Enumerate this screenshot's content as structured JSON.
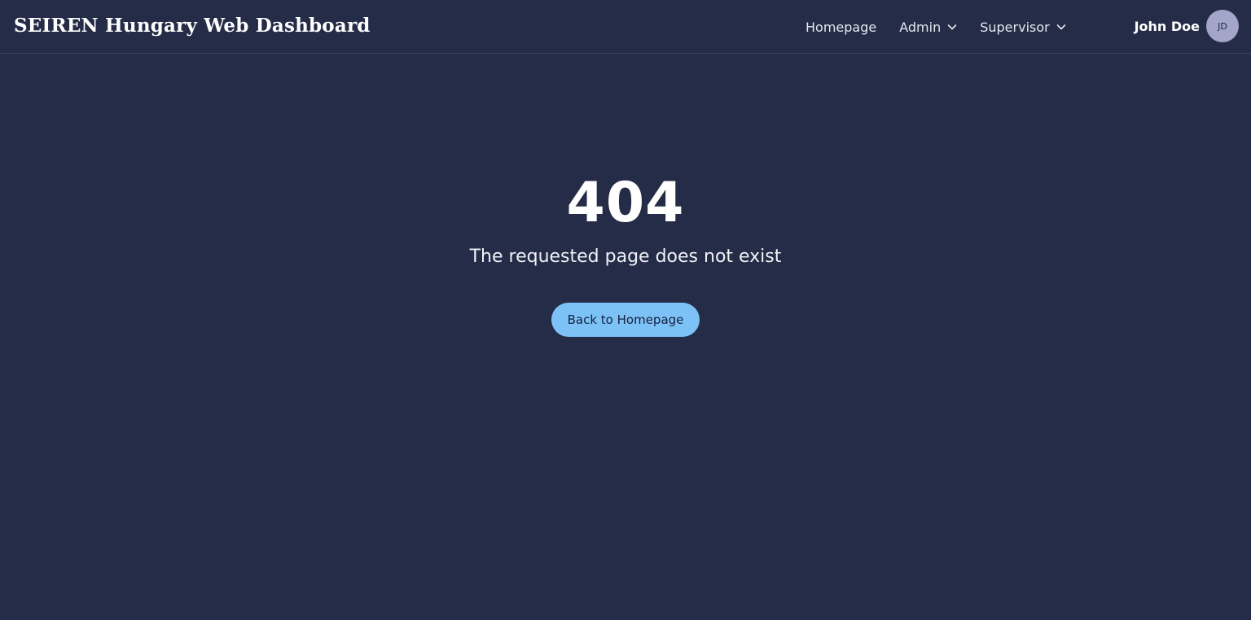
{
  "navbar": {
    "brand": "SEIREN Hungary Web Dashboard",
    "links": [
      {
        "label": "Homepage"
      },
      {
        "label": "Admin",
        "icon": "chevron-down-icon"
      },
      {
        "label": "Supervisor",
        "icon": "chevron-down-icon"
      }
    ],
    "user": {
      "name": "John Doe",
      "initials": "JD"
    }
  },
  "error": {
    "code": "404",
    "message": "The requested page does not exist",
    "button_label": "Back to Homepage"
  },
  "colors": {
    "background": "#252c47",
    "accent_button": "#7cc2f7",
    "avatar": "#a3a6c9"
  }
}
